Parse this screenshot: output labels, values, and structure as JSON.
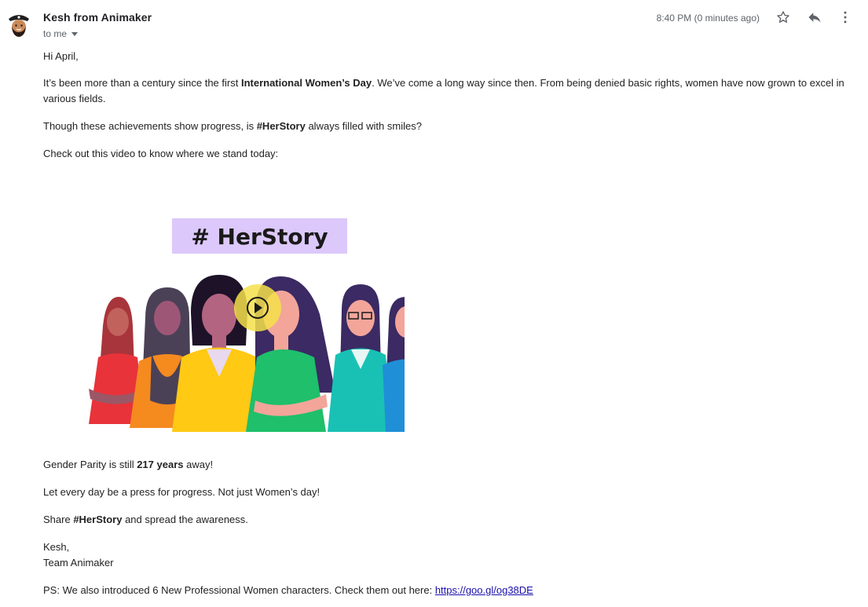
{
  "header": {
    "sender": "Kesh from Animaker",
    "recipient": "to me",
    "timestamp": "8:40 PM (0 minutes ago)"
  },
  "icons": {
    "avatar": "pirate-avatar",
    "star": "star-icon",
    "reply": "reply-icon",
    "more": "more-vert-icon",
    "play": "play-icon"
  },
  "body": {
    "greeting": "Hi April,",
    "p1_a": "It’s been more than a century since the first ",
    "p1_b": "International Women’s Day",
    "p1_c": ". We’ve come a long way since then. From being denied basic rights, women have now grown to excel in various fields.",
    "p2_a": "Though these achievements show progress, is ",
    "p2_b": "#HerStory",
    "p2_c": " always filled with smiles?",
    "p3": "Check out this video to know where we stand today:",
    "banner": "# HerStory",
    "p4_a": "Gender Parity is still ",
    "p4_b": "217 years",
    "p4_c": " away!",
    "p5": "Let every day be a press for progress. Not just Women’s day!",
    "p6_a": "Share ",
    "p6_b": "#HerStory",
    "p6_c": " and spread the awareness.",
    "sign1": "Kesh,",
    "sign2": "Team Animaker",
    "ps_text": "PS: We also introduced 6 New Professional Women characters. Check them out here: ",
    "ps_link": "https://goo.gl/og38DE"
  },
  "colors": {
    "banner_bg": "#dcc8fb",
    "play_circle": "#f5e04a",
    "link": "#1a0dab"
  }
}
